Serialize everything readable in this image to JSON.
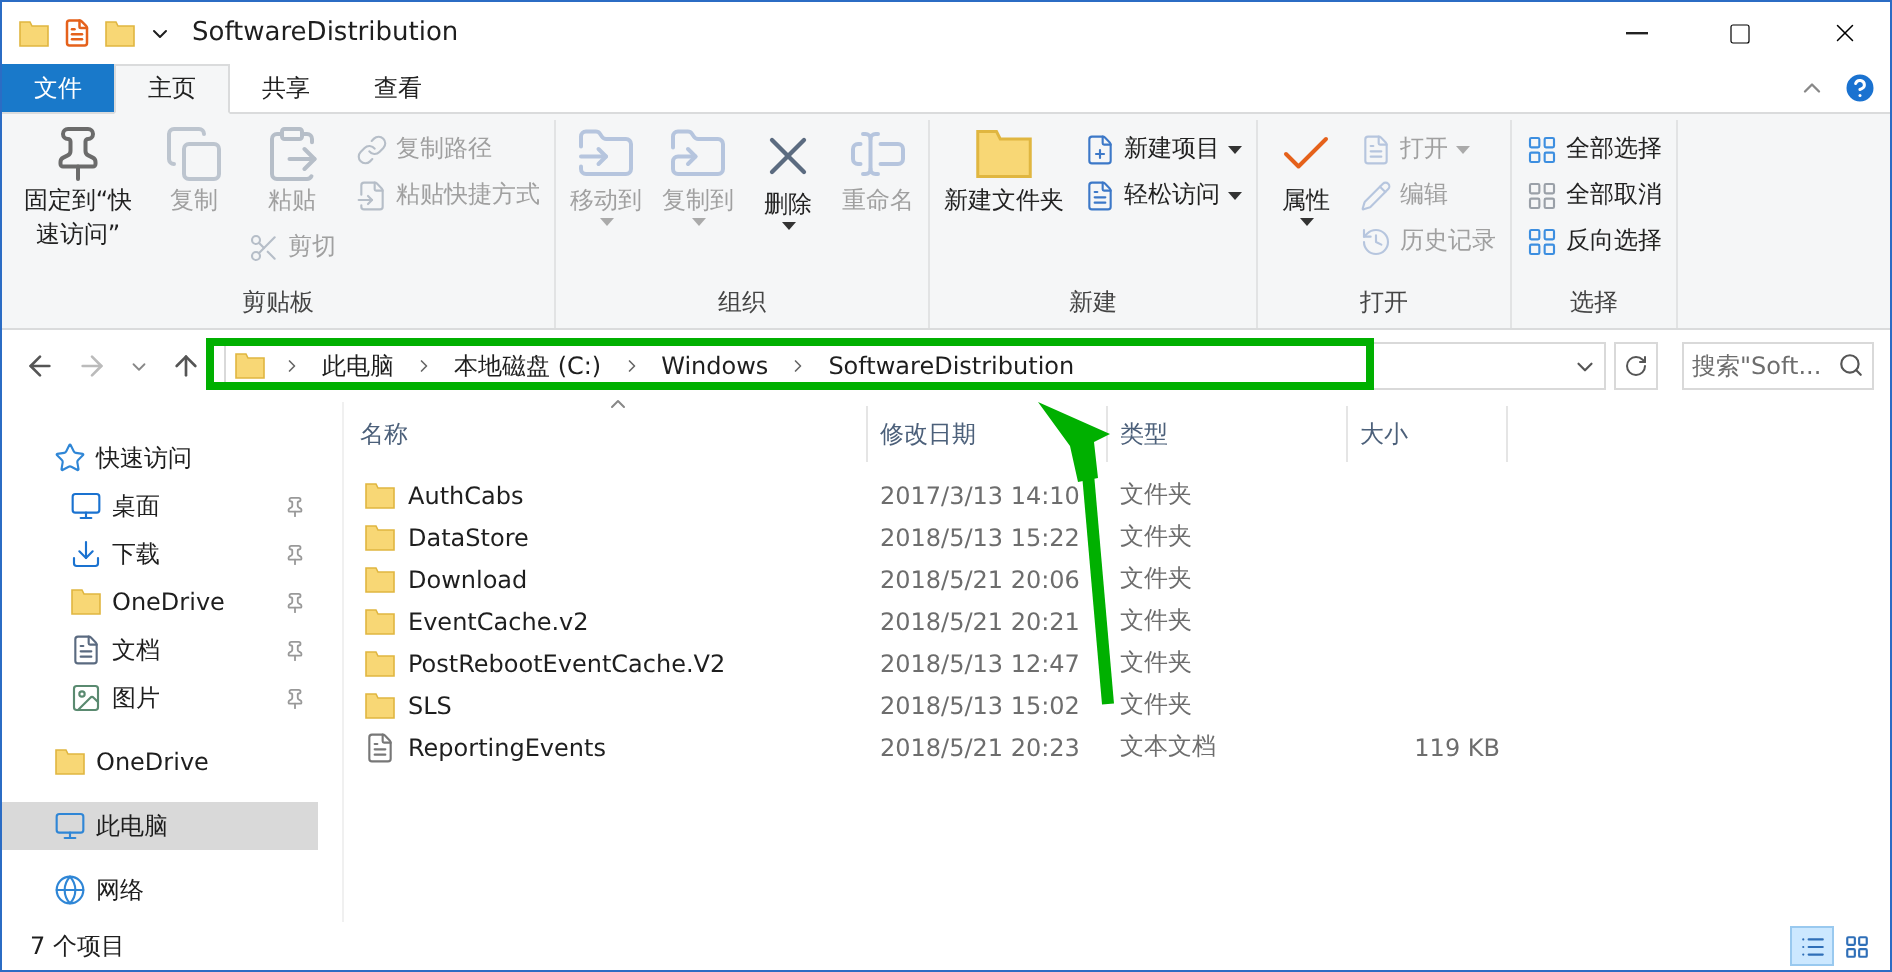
{
  "window": {
    "title": "SoftwareDistribution"
  },
  "ribbon_tabs": [
    {
      "label": "文件",
      "kind": "file",
      "selected": false
    },
    {
      "label": "主页",
      "kind": "tab",
      "selected": true
    },
    {
      "label": "共享",
      "kind": "tab",
      "selected": false
    },
    {
      "label": "查看",
      "kind": "tab",
      "selected": false
    }
  ],
  "ribbon_groups": [
    {
      "label": "剪贴板",
      "columns": [
        [
          {
            "label": "固定到“快速访问”",
            "kind": "large",
            "disabled": false,
            "dropdown": false
          }
        ],
        [
          {
            "label": "复制",
            "kind": "large",
            "disabled": true,
            "dropdown": false
          }
        ],
        [
          {
            "label": "粘贴",
            "kind": "large",
            "disabled": true,
            "dropdown": false
          },
          {
            "label": "剪切",
            "kind": "small",
            "disabled": true,
            "dropdown": false
          }
        ],
        [
          {
            "label": "复制路径",
            "kind": "small",
            "disabled": true,
            "dropdown": false
          },
          {
            "label": "粘贴快捷方式",
            "kind": "small",
            "disabled": true,
            "dropdown": false
          }
        ]
      ]
    },
    {
      "label": "组织",
      "columns": [
        [
          {
            "label": "移动到",
            "kind": "large",
            "disabled": true,
            "dropdown": true
          }
        ],
        [
          {
            "label": "复制到",
            "kind": "large",
            "disabled": true,
            "dropdown": true
          }
        ],
        [
          {
            "label": "删除",
            "kind": "large",
            "disabled": false,
            "dropdown": true
          }
        ],
        [
          {
            "label": "重命名",
            "kind": "large",
            "disabled": true,
            "dropdown": false
          }
        ]
      ]
    },
    {
      "label": "新建",
      "columns": [
        [
          {
            "label": "新建文件夹",
            "kind": "large",
            "disabled": false,
            "dropdown": false
          }
        ],
        [
          {
            "label": "新建项目",
            "kind": "small",
            "disabled": false,
            "dropdown": true
          },
          {
            "label": "轻松访问",
            "kind": "small",
            "disabled": false,
            "dropdown": true
          }
        ]
      ]
    },
    {
      "label": "打开",
      "columns": [
        [
          {
            "label": "属性",
            "kind": "large",
            "disabled": false,
            "dropdown": true
          }
        ],
        [
          {
            "label": "打开",
            "kind": "small",
            "disabled": true,
            "dropdown": true
          },
          {
            "label": "编辑",
            "kind": "small",
            "disabled": true,
            "dropdown": false
          },
          {
            "label": "历史记录",
            "kind": "small",
            "disabled": true,
            "dropdown": false
          }
        ]
      ]
    },
    {
      "label": "选择",
      "columns": [
        [
          {
            "label": "全部选择",
            "kind": "small",
            "disabled": false,
            "dropdown": false
          },
          {
            "label": "全部取消",
            "kind": "small",
            "disabled": false,
            "dropdown": false
          },
          {
            "label": "反向选择",
            "kind": "small",
            "disabled": false,
            "dropdown": false
          }
        ]
      ]
    }
  ],
  "address": {
    "path": [
      "此电脑",
      "本地磁盘 (C:)",
      "Windows",
      "SoftwareDistribution"
    ]
  },
  "search": {
    "placeholder": "搜索\"Soft..."
  },
  "sidebar": {
    "items": [
      {
        "label": "快速访问",
        "selected": false,
        "children": [
          {
            "label": "桌面",
            "pinned": true
          },
          {
            "label": "下载",
            "pinned": true
          },
          {
            "label": "OneDrive",
            "pinned": true
          },
          {
            "label": "文档",
            "pinned": true
          },
          {
            "label": "图片",
            "pinned": true
          }
        ]
      },
      {
        "label": "OneDrive",
        "selected": false
      },
      {
        "label": "此电脑",
        "selected": true
      },
      {
        "label": "网络",
        "selected": false
      }
    ]
  },
  "table": {
    "columns": [
      {
        "label": "名称",
        "sorted": true
      },
      {
        "label": "修改日期",
        "sorted": false
      },
      {
        "label": "类型",
        "sorted": false
      },
      {
        "label": "大小",
        "sorted": false
      }
    ],
    "rows": [
      {
        "kind": "folder",
        "name": "AuthCabs",
        "date": "2017/3/13 14:10",
        "type": "文件夹"
      },
      {
        "kind": "folder",
        "name": "DataStore",
        "date": "2018/5/13 15:22",
        "type": "文件夹"
      },
      {
        "kind": "folder",
        "name": "Download",
        "date": "2018/5/21 20:06",
        "type": "文件夹"
      },
      {
        "kind": "folder",
        "name": "EventCache.v2",
        "date": "2018/5/21 20:21",
        "type": "文件夹"
      },
      {
        "kind": "folder",
        "name": "PostRebootEventCache.V2",
        "date": "2018/5/13 12:47",
        "type": "文件夹"
      },
      {
        "kind": "folder",
        "name": "SLS",
        "date": "2018/5/13 15:02",
        "type": "文件夹"
      },
      {
        "kind": "file",
        "name": "ReportingEvents",
        "date": "2018/5/21 20:23",
        "type": "文本文档",
        "size": "119 KB"
      }
    ]
  },
  "status_bar": {
    "count": "7 个项目",
    "views": [
      {
        "selected": true
      },
      {
        "selected": false
      }
    ]
  }
}
